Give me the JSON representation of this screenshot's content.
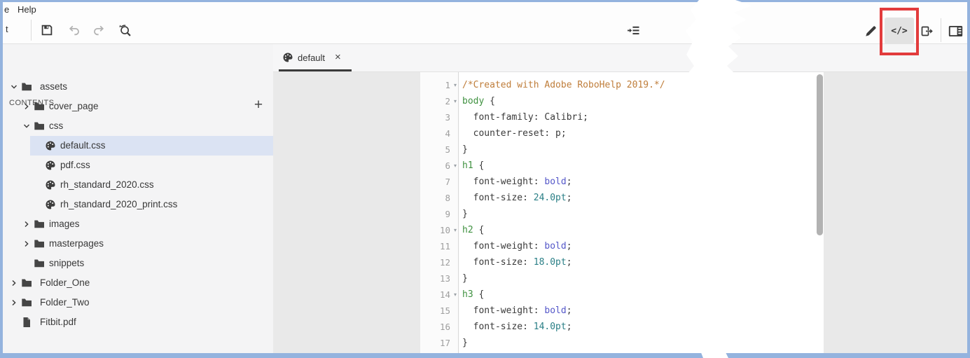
{
  "colors": {
    "window_border": "#94b3de",
    "selection_bg": "#dbe3f3",
    "annotation_red": "#e23b3c"
  },
  "menu_bar": {
    "partial_left": "e",
    "help_label": "Help"
  },
  "toolbar": {
    "partial_left": "t",
    "icons": [
      "save-icon",
      "undo-icon",
      "redo-icon",
      "find-replace-icon",
      "indent-icon"
    ],
    "right_icons": [
      "edit-pencil-icon",
      "code-view-icon",
      "export-icon",
      "layout-panel-icon"
    ],
    "code_view_glyph": "</>"
  },
  "contents_panel": {
    "title": "CONTENTS",
    "add_glyph": "+",
    "tree": [
      {
        "label": "assets",
        "icon": "folder",
        "chevron": "down",
        "indent": 0,
        "selected": false
      },
      {
        "label": "cover_page",
        "icon": "folder",
        "chevron": "right",
        "indent": 1,
        "selected": false
      },
      {
        "label": "css",
        "icon": "folder",
        "chevron": "down",
        "indent": 1,
        "selected": false
      },
      {
        "label": "default.css",
        "icon": "css",
        "chevron": "none",
        "indent": 2,
        "selected": true
      },
      {
        "label": "pdf.css",
        "icon": "css",
        "chevron": "none",
        "indent": 2,
        "selected": false
      },
      {
        "label": "rh_standard_2020.css",
        "icon": "css",
        "chevron": "none",
        "indent": 2,
        "selected": false
      },
      {
        "label": "rh_standard_2020_print.css",
        "icon": "css",
        "chevron": "none",
        "indent": 2,
        "selected": false
      },
      {
        "label": "images",
        "icon": "folder",
        "chevron": "right",
        "indent": 1,
        "selected": false
      },
      {
        "label": "masterpages",
        "icon": "folder",
        "chevron": "right",
        "indent": 1,
        "selected": false
      },
      {
        "label": "snippets",
        "icon": "folder",
        "chevron": "none",
        "indent": 1,
        "selected": false
      },
      {
        "label": "Folder_One",
        "icon": "folder",
        "chevron": "right",
        "indent": 0,
        "selected": false
      },
      {
        "label": "Folder_Two",
        "icon": "folder",
        "chevron": "right",
        "indent": 0,
        "selected": false
      },
      {
        "label": "Fitbit.pdf",
        "icon": "pdf",
        "chevron": "none",
        "indent": 0,
        "selected": false
      }
    ]
  },
  "tab_bar": {
    "tabs": [
      {
        "label": "default",
        "icon": "css",
        "close_glyph": "×",
        "active": true
      }
    ]
  },
  "editor": {
    "fold_glyph": "▾",
    "colors": {
      "comment": "#bf7d3a",
      "selector": "#3f9140",
      "keyword": "#5457c9",
      "number": "#2a7f86",
      "plain": "#3a3a3a"
    },
    "lines": [
      {
        "num": 1,
        "fold": true,
        "tokens": [
          {
            "t": "/*Created with Adobe RoboHelp 2019.*/",
            "c": "comment"
          }
        ]
      },
      {
        "num": 2,
        "fold": true,
        "tokens": [
          {
            "t": "body",
            "c": "selector"
          },
          {
            "t": " {",
            "c": "plain"
          }
        ]
      },
      {
        "num": 3,
        "fold": false,
        "tokens": [
          {
            "t": "  font-family: Calibri;",
            "c": "plain"
          }
        ]
      },
      {
        "num": 4,
        "fold": false,
        "tokens": [
          {
            "t": "  counter-reset: p;",
            "c": "plain"
          }
        ]
      },
      {
        "num": 5,
        "fold": false,
        "tokens": [
          {
            "t": "}",
            "c": "plain"
          }
        ]
      },
      {
        "num": 6,
        "fold": true,
        "tokens": [
          {
            "t": "h1",
            "c": "selector"
          },
          {
            "t": " {",
            "c": "plain"
          }
        ]
      },
      {
        "num": 7,
        "fold": false,
        "tokens": [
          {
            "t": "  font-weight: ",
            "c": "plain"
          },
          {
            "t": "bold",
            "c": "keyword"
          },
          {
            "t": ";",
            "c": "plain"
          }
        ]
      },
      {
        "num": 8,
        "fold": false,
        "tokens": [
          {
            "t": "  font-size: ",
            "c": "plain"
          },
          {
            "t": "24.0pt",
            "c": "number"
          },
          {
            "t": ";",
            "c": "plain"
          }
        ]
      },
      {
        "num": 9,
        "fold": false,
        "tokens": [
          {
            "t": "}",
            "c": "plain"
          }
        ]
      },
      {
        "num": 10,
        "fold": true,
        "tokens": [
          {
            "t": "h2",
            "c": "selector"
          },
          {
            "t": " {",
            "c": "plain"
          }
        ]
      },
      {
        "num": 11,
        "fold": false,
        "tokens": [
          {
            "t": "  font-weight: ",
            "c": "plain"
          },
          {
            "t": "bold",
            "c": "keyword"
          },
          {
            "t": ";",
            "c": "plain"
          }
        ]
      },
      {
        "num": 12,
        "fold": false,
        "tokens": [
          {
            "t": "  font-size: ",
            "c": "plain"
          },
          {
            "t": "18.0pt",
            "c": "number"
          },
          {
            "t": ";",
            "c": "plain"
          }
        ]
      },
      {
        "num": 13,
        "fold": false,
        "tokens": [
          {
            "t": "}",
            "c": "plain"
          }
        ]
      },
      {
        "num": 14,
        "fold": true,
        "tokens": [
          {
            "t": "h3",
            "c": "selector"
          },
          {
            "t": " {",
            "c": "plain"
          }
        ]
      },
      {
        "num": 15,
        "fold": false,
        "tokens": [
          {
            "t": "  font-weight: ",
            "c": "plain"
          },
          {
            "t": "bold",
            "c": "keyword"
          },
          {
            "t": ";",
            "c": "plain"
          }
        ]
      },
      {
        "num": 16,
        "fold": false,
        "tokens": [
          {
            "t": "  font-size: ",
            "c": "plain"
          },
          {
            "t": "14.0pt",
            "c": "number"
          },
          {
            "t": ";",
            "c": "plain"
          }
        ]
      },
      {
        "num": 17,
        "fold": false,
        "tokens": [
          {
            "t": "}",
            "c": "plain"
          }
        ]
      }
    ]
  }
}
